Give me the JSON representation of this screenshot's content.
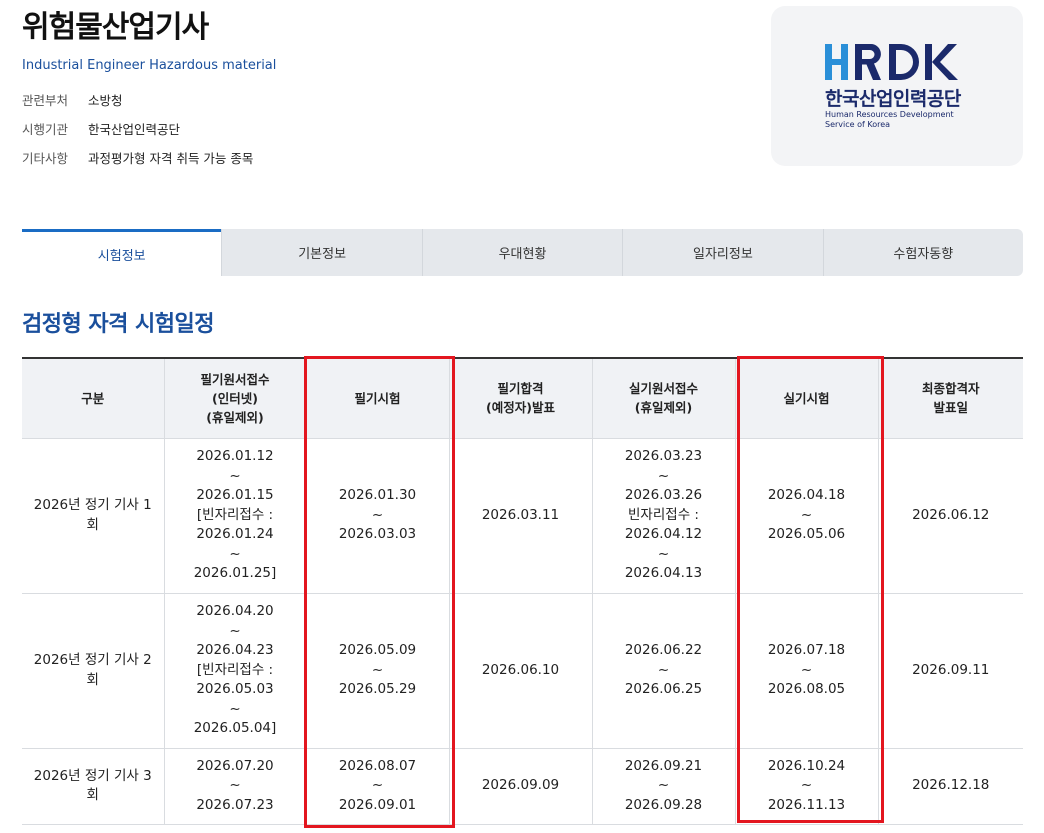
{
  "header": {
    "title": "위험물산업기사",
    "subtitle": "Industrial Engineer Hazardous material",
    "meta": [
      {
        "key": "관련부처",
        "value": "소방청"
      },
      {
        "key": "시행기관",
        "value": "한국산업인력공단"
      },
      {
        "key": "기타사항",
        "value": "과정평가형 자격 취득 가능 종목"
      }
    ]
  },
  "logo": {
    "mark": "HRDK",
    "korean": "한국산업인력공단",
    "english_line1": "Human Resources Development",
    "english_line2": "Service of Korea",
    "colors": {
      "primary": "#1b2a6b",
      "accent": "#2a8fd8"
    }
  },
  "tabs": [
    {
      "label": "시험정보",
      "active": true
    },
    {
      "label": "기본정보",
      "active": false
    },
    {
      "label": "우대현황",
      "active": false
    },
    {
      "label": "일자리정보",
      "active": false
    },
    {
      "label": "수험자동향",
      "active": false
    }
  ],
  "section_title": "검정형 자격 시험일정",
  "table": {
    "headers": [
      "구분",
      "필기원서접수\n(인터넷)\n(휴일제외)",
      "필기시험",
      "필기합격\n(예정자)발표",
      "실기원서접수\n(휴일제외)",
      "실기시험",
      "최종합격자\n발표일"
    ],
    "rows": [
      {
        "round": "2026년 정기 기사 1\n회",
        "written_application": "2026.01.12\n~\n2026.01.15\n[빈자리접수 :\n2026.01.24\n~\n2026.01.25]",
        "written_exam": "2026.01.30\n~\n2026.03.03",
        "written_result": "2026.03.11",
        "practical_application": "2026.03.23\n~\n2026.03.26\n빈자리접수 :\n2026.04.12\n~\n2026.04.13",
        "practical_exam": "2026.04.18\n~\n2026.05.06",
        "final_result": "2026.06.12"
      },
      {
        "round": "2026년 정기 기사 2\n회",
        "written_application": "2026.04.20\n~\n2026.04.23\n[빈자리접수 :\n2026.05.03\n~\n2026.05.04]",
        "written_exam": "2026.05.09\n~\n2026.05.29",
        "written_result": "2026.06.10",
        "practical_application": "2026.06.22\n~\n2026.06.25",
        "practical_exam": "2026.07.18\n~\n2026.08.05",
        "final_result": "2026.09.11"
      },
      {
        "round": "2026년 정기 기사 3\n회",
        "written_application": "2026.07.20\n~\n2026.07.23",
        "written_exam": "2026.08.07\n~\n2026.09.01",
        "written_result": "2026.09.09",
        "practical_application": "2026.09.21\n~\n2026.09.28",
        "practical_exam": "2026.10.24\n~\n2026.11.13",
        "final_result": "2026.12.18"
      }
    ]
  },
  "highlight_color": "#e3161f"
}
